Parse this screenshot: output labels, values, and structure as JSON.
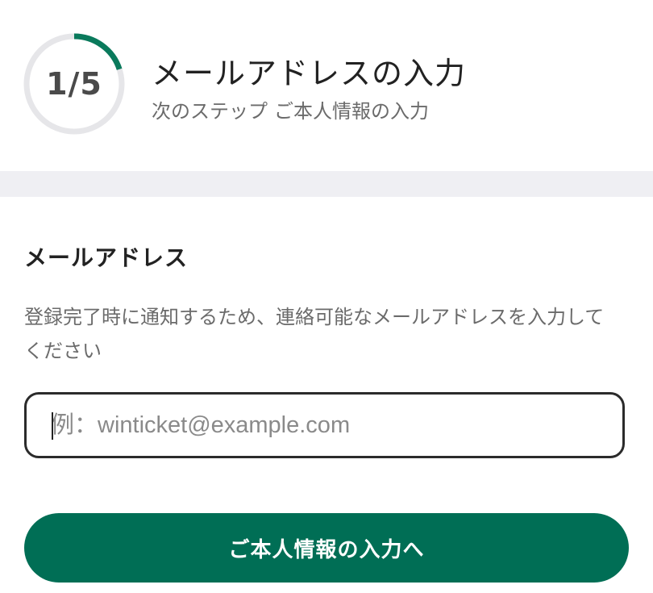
{
  "header": {
    "progress": {
      "current": 1,
      "total": 5,
      "label": "1/5",
      "fraction": 0.2,
      "track_color": "#e6e6e9",
      "fill_color": "#0a7a5c"
    },
    "title": "メールアドレスの入力",
    "next_step_prefix": "次のステップ",
    "next_step_name": "ご本人情報の入力"
  },
  "form": {
    "section_label": "メールアドレス",
    "description": "登録完了時に通知するため、連絡可能なメールアドレスを入力してください",
    "email": {
      "value": "",
      "placeholder": "例：winticket@example.com"
    },
    "submit_label": "ご本人情報の入力へ"
  },
  "colors": {
    "primary": "#006e55",
    "band": "#efeff3",
    "text": "#222222",
    "muted_text": "#6b6b6b"
  }
}
